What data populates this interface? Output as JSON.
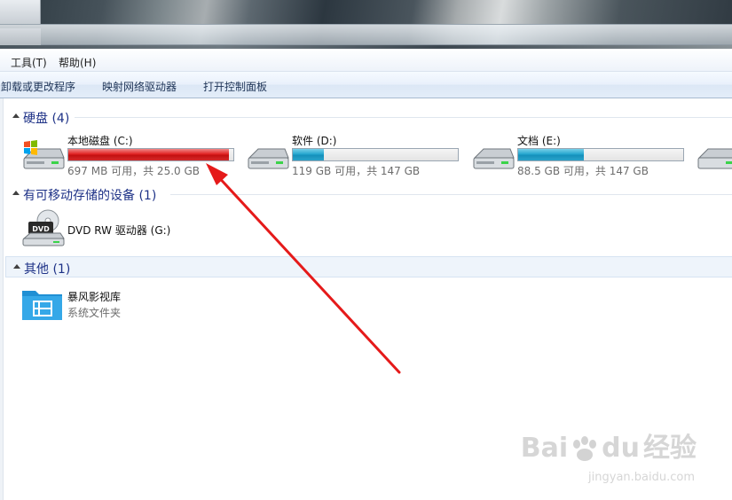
{
  "menu": {
    "tools": "工具(T)",
    "help": "帮助(H)"
  },
  "toolbar": {
    "uninstall": "卸载或更改程序",
    "map_drive": "映射网络驱动器",
    "control_panel": "打开控制面板"
  },
  "groups": {
    "hard_disks": "硬盘 (4)",
    "removable": "有可移动存储的设备 (1)",
    "other": "其他 (1)"
  },
  "drives": [
    {
      "name": "本地磁盘 (C:)",
      "info": "697 MB 可用，共 25.0 GB",
      "used_fraction": 0.973,
      "bar_color": "#d42020"
    },
    {
      "name": "软件 (D:)",
      "info": "119 GB 可用，共 147 GB",
      "used_fraction": 0.19,
      "bar_color": "#1f9cc8"
    },
    {
      "name": "文档 (E:)",
      "info": "88.5 GB 可用，共 147 GB",
      "used_fraction": 0.398,
      "bar_color": "#1f9cc8"
    }
  ],
  "removable": {
    "name": "DVD RW 驱动器 (G:)",
    "icon_label": "DVD"
  },
  "other": {
    "name": "暴风影视库",
    "sub": "系统文件夹"
  },
  "watermark": {
    "main": "Bai",
    "main2": "du",
    "brand": "经验",
    "sub": "jingyan.baidu.com"
  }
}
